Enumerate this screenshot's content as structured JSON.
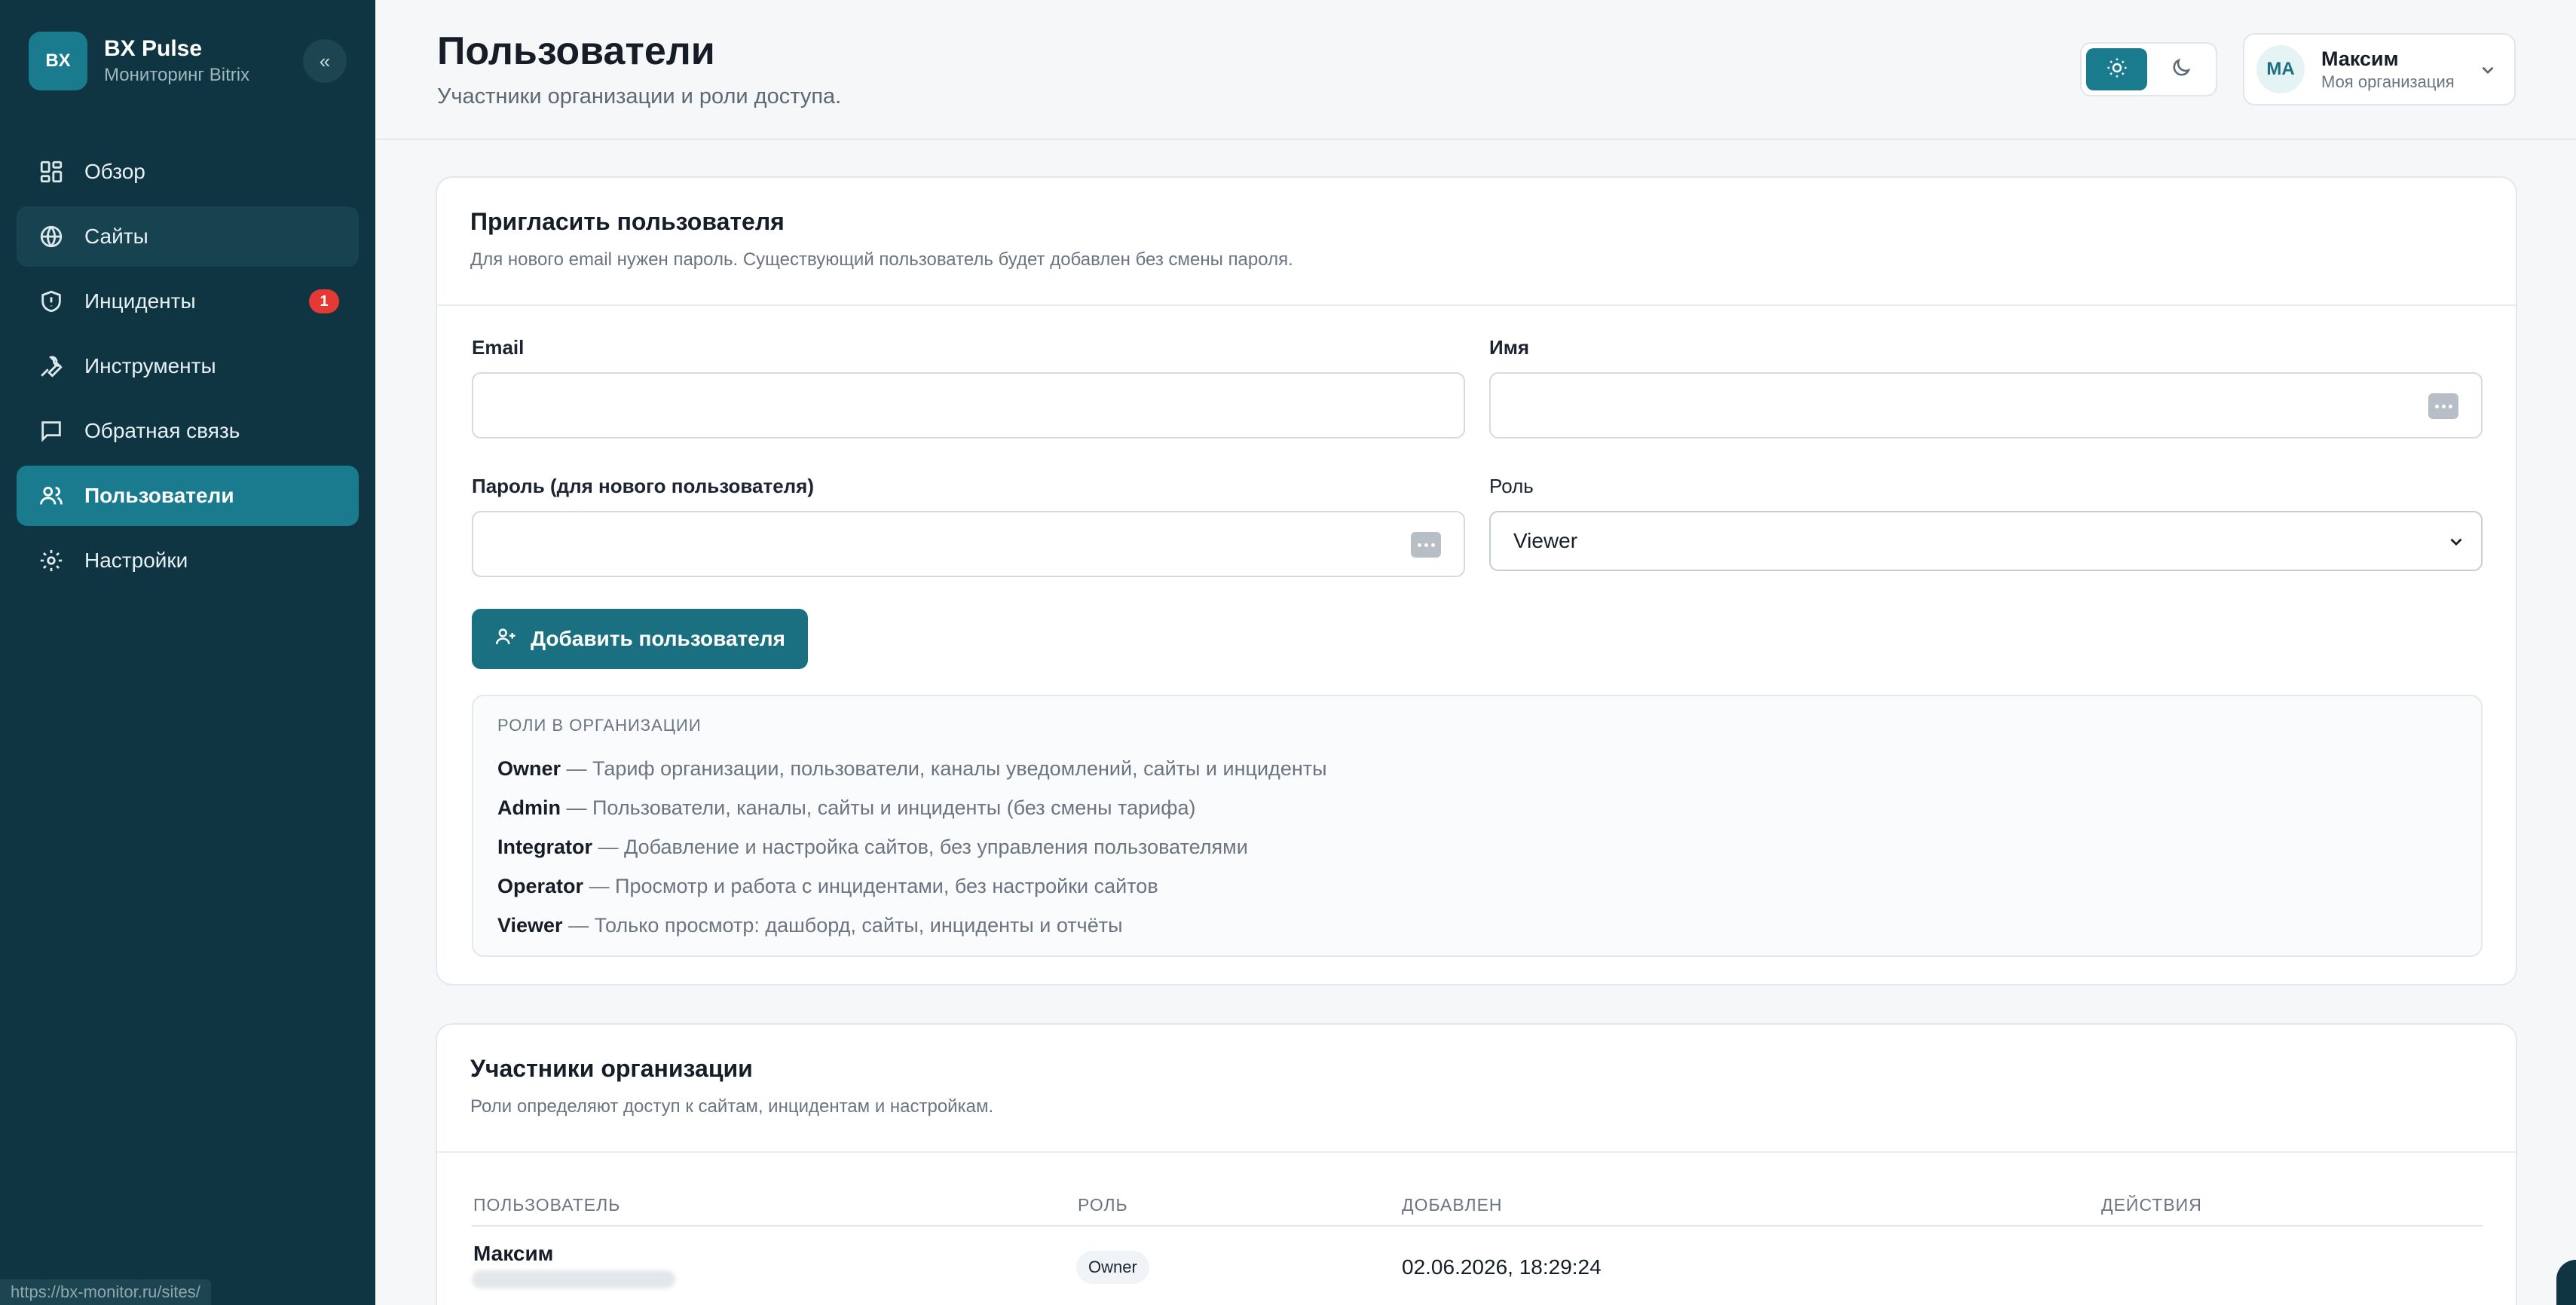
{
  "brand": {
    "logo": "BX",
    "title": "BX Pulse",
    "subtitle": "Мониторинг Bitrix",
    "collapse_icon": "«"
  },
  "nav": {
    "items": [
      {
        "label": "Обзор",
        "icon": "grid-icon"
      },
      {
        "label": "Сайты",
        "icon": "globe-icon",
        "hovered": true
      },
      {
        "label": "Инциденты",
        "icon": "shield-alert-icon",
        "badge": "1"
      },
      {
        "label": "Инструменты",
        "icon": "wrench-icon"
      },
      {
        "label": "Обратная связь",
        "icon": "message-icon"
      },
      {
        "label": "Пользователи",
        "icon": "users-icon",
        "active": true
      },
      {
        "label": "Настройки",
        "icon": "gear-icon"
      }
    ]
  },
  "status_url": "https://bx-monitor.ru/sites/",
  "header": {
    "title": "Пользователи",
    "subtitle": "Участники организации и роли доступа."
  },
  "user": {
    "initials": "MA",
    "name": "Максим",
    "org": "Моя организация"
  },
  "invite": {
    "title": "Пригласить пользователя",
    "description": "Для нового email нужен пароль. Существующий пользователь будет добавлен без смены пароля.",
    "email_label": "Email",
    "email_value": "",
    "name_label": "Имя",
    "name_value": "",
    "password_label": "Пароль (для нового пользователя)",
    "password_value": "",
    "role_label": "Роль",
    "role_selected": "Viewer",
    "add_button": "Добавить пользователя"
  },
  "roles": {
    "title": "Роли в организации",
    "items": [
      {
        "name": "Owner",
        "desc": " — Тариф организации, пользователи, каналы уведомлений, сайты и инциденты"
      },
      {
        "name": "Admin",
        "desc": " — Пользователи, каналы, сайты и инциденты (без смены тарифа)"
      },
      {
        "name": "Integrator",
        "desc": " — Добавление и настройка сайтов, без управления пользователями"
      },
      {
        "name": "Operator",
        "desc": " — Просмотр и работа с инцидентами, без настройки сайтов"
      },
      {
        "name": "Viewer",
        "desc": " — Только просмотр: дашборд, сайты, инциденты и отчёты"
      }
    ]
  },
  "members": {
    "title": "Участники организации",
    "description": "Роли определяют доступ к сайтам, инцидентам и настройкам.",
    "columns": [
      "Пользователь",
      "Роль",
      "Добавлен",
      "Действия"
    ],
    "rows": [
      {
        "name": "Максим",
        "role": "Owner",
        "added": "02.06.2026, 18:29:24"
      }
    ]
  },
  "colors": {
    "sidebar_bg": "#0f3542",
    "accent": "#1a7b8f",
    "badge": "#e53935"
  }
}
